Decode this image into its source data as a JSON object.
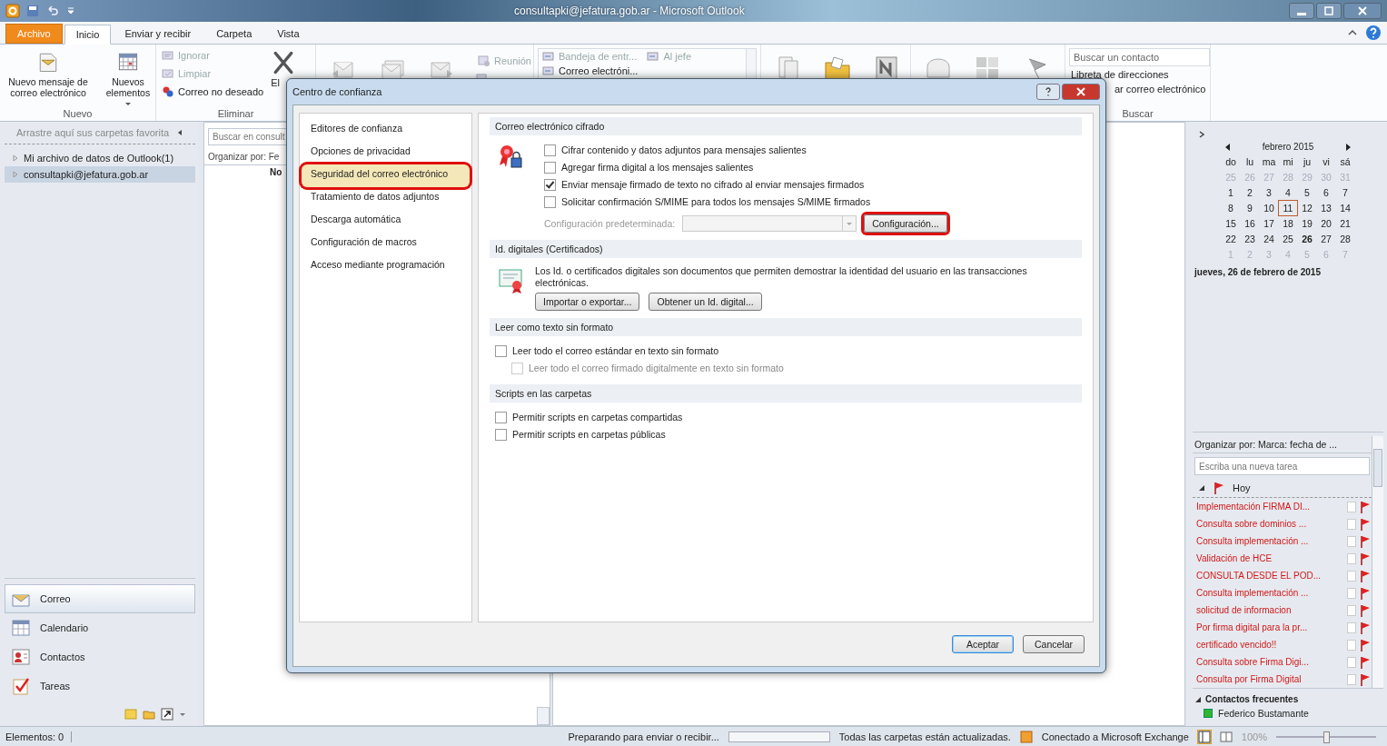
{
  "window": {
    "title": "consultapki@jefatura.gob.ar - Microsoft Outlook"
  },
  "tabs": [
    {
      "label": "Archivo",
      "kind": "file",
      "selected": false
    },
    {
      "label": "Inicio",
      "kind": "tab",
      "selected": true
    },
    {
      "label": "Enviar y recibir",
      "kind": "tab",
      "selected": false
    },
    {
      "label": "Carpeta",
      "kind": "tab",
      "selected": false
    },
    {
      "label": "Vista",
      "kind": "tab",
      "selected": false
    }
  ],
  "ribbon": {
    "new_mail": "Nuevo mensaje de correo electrónico",
    "new_items": "Nuevos elementos",
    "group_new": "Nuevo",
    "ignore": {
      "label": "Ignorar",
      "disabled": true
    },
    "clean": {
      "label": "Limpiar",
      "disabled": true
    },
    "junk": {
      "label": "Correo no deseado",
      "disabled": false
    },
    "delete_label": "El",
    "group_delete": "Eliminar",
    "meeting": {
      "label": "Reunión",
      "disabled": true
    },
    "quick_steps": [
      {
        "label": "Bandeja de entr...",
        "disabled": true
      },
      {
        "label": "Al jefe",
        "disabled": true
      },
      {
        "label": "Correo electróni...",
        "disabled": false
      }
    ],
    "contact_search": {
      "placeholder": "Buscar un contacto"
    },
    "address_book": "Libreta de direcciones",
    "filter_mail": "ar correo electrónico",
    "group_find": "Buscar"
  },
  "nav_pane": {
    "favorites_hint": "Arrastre aquí sus carpetas favorita",
    "folders": [
      {
        "label": "Mi archivo de datos de Outlook(1)",
        "expanded": false,
        "selected": false
      },
      {
        "label": "consultapki@jefatura.gob.ar",
        "expanded": false,
        "selected": true
      }
    ],
    "modules": [
      {
        "label": "Correo",
        "selected": true
      },
      {
        "label": "Calendario",
        "selected": false
      },
      {
        "label": "Contactos",
        "selected": false
      },
      {
        "label": "Tareas",
        "selected": false
      }
    ]
  },
  "mail_list": {
    "search_placeholder": "Buscar en consult",
    "arrange": "Organizar por: Fe",
    "column_text": "No"
  },
  "dialog": {
    "title": "Centro de confianza",
    "categories": [
      {
        "label": "Editores de confianza",
        "selected": false,
        "annotated": false
      },
      {
        "label": "Opciones de privacidad",
        "selected": false,
        "annotated": false
      },
      {
        "label": "Seguridad del correo electrónico",
        "selected": true,
        "annotated": true
      },
      {
        "label": "Tratamiento de datos adjuntos",
        "selected": false,
        "annotated": false
      },
      {
        "label": "Descarga automática",
        "selected": false,
        "annotated": false
      },
      {
        "label": "Configuración de macros",
        "selected": false,
        "annotated": false
      },
      {
        "label": "Acceso mediante programación",
        "selected": false,
        "annotated": false
      }
    ],
    "encryption": {
      "title": "Correo electrónico cifrado",
      "options": [
        {
          "label": "Cifrar contenido y datos adjuntos para mensajes salientes",
          "checked": false
        },
        {
          "label": "Agregar firma digital a los mensajes salientes",
          "checked": false
        },
        {
          "label": "Enviar mensaje firmado de texto no cifrado al enviar mensajes firmados",
          "checked": true
        },
        {
          "label": "Solicitar confirmación S/MIME para todos los mensajes S/MIME firmados",
          "checked": false
        }
      ],
      "default_setting_label": "Configuración predeterminada:",
      "settings_button": {
        "label": "Configuración...",
        "annotated": true
      }
    },
    "digital_ids": {
      "title": "Id. digitales (Certificados)",
      "description": "Los Id. o certificados digitales son documentos que permiten demostrar la identidad del usuario en las transacciones electrónicas.",
      "buttons": [
        "Importar o exportar...",
        "Obtener un Id. digital..."
      ]
    },
    "plain_text": {
      "title": "Leer como texto sin formato",
      "options": [
        {
          "label": "Leer todo el correo estándar en texto sin formato",
          "checked": false,
          "disabled": false,
          "children": [
            {
              "label": "Leer todo el correo firmado digitalmente en texto sin formato",
              "checked": false,
              "disabled": true
            }
          ]
        }
      ]
    },
    "scripts": {
      "title": "Scripts en las carpetas",
      "options": [
        {
          "label": "Permitir scripts en carpetas compartidas",
          "checked": false
        },
        {
          "label": "Permitir scripts en carpetas públicas",
          "checked": false
        }
      ]
    },
    "buttons": [
      {
        "label": "Aceptar",
        "default": true
      },
      {
        "label": "Cancelar",
        "default": false
      }
    ]
  },
  "todo_bar": {
    "calendar": {
      "month": "febrero 2015",
      "weekdays": [
        "do",
        "lu",
        "ma",
        "mi",
        "ju",
        "vi",
        "sá"
      ],
      "weeks": [
        [
          {
            "t": "25",
            "muted": true,
            "selected": false,
            "bold": false
          },
          {
            "t": "26",
            "muted": true,
            "selected": false,
            "bold": false
          },
          {
            "t": "27",
            "muted": true,
            "selected": false,
            "bold": false
          },
          {
            "t": "28",
            "muted": true,
            "selected": false,
            "bold": false
          },
          {
            "t": "29",
            "muted": true,
            "selected": false,
            "bold": false
          },
          {
            "t": "30",
            "muted": true,
            "selected": false,
            "bold": false
          },
          {
            "t": "31",
            "muted": true,
            "selected": false,
            "bold": false
          }
        ],
        [
          {
            "t": "1",
            "muted": false,
            "selected": false,
            "bold": false
          },
          {
            "t": "2",
            "muted": false,
            "selected": false,
            "bold": false
          },
          {
            "t": "3",
            "muted": false,
            "selected": false,
            "bold": false
          },
          {
            "t": "4",
            "muted": false,
            "selected": false,
            "bold": false
          },
          {
            "t": "5",
            "muted": false,
            "selected": false,
            "bold": false
          },
          {
            "t": "6",
            "muted": false,
            "selected": false,
            "bold": false
          },
          {
            "t": "7",
            "muted": false,
            "selected": false,
            "bold": false
          }
        ],
        [
          {
            "t": "8",
            "muted": false,
            "selected": false,
            "bold": false
          },
          {
            "t": "9",
            "muted": false,
            "selected": false,
            "bold": false
          },
          {
            "t": "10",
            "muted": false,
            "selected": false,
            "bold": false
          },
          {
            "t": "11",
            "muted": false,
            "selected": true,
            "bold": false
          },
          {
            "t": "12",
            "muted": false,
            "selected": false,
            "bold": false
          },
          {
            "t": "13",
            "muted": false,
            "selected": false,
            "bold": false
          },
          {
            "t": "14",
            "muted": false,
            "selected": false,
            "bold": false
          }
        ],
        [
          {
            "t": "15",
            "muted": false,
            "selected": false,
            "bold": false
          },
          {
            "t": "16",
            "muted": false,
            "selected": false,
            "bold": false
          },
          {
            "t": "17",
            "muted": false,
            "selected": false,
            "bold": false
          },
          {
            "t": "18",
            "muted": false,
            "selected": false,
            "bold": false
          },
          {
            "t": "19",
            "muted": false,
            "selected": false,
            "bold": false
          },
          {
            "t": "20",
            "muted": false,
            "selected": false,
            "bold": false
          },
          {
            "t": "21",
            "muted": false,
            "selected": false,
            "bold": false
          }
        ],
        [
          {
            "t": "22",
            "muted": false,
            "selected": false,
            "bold": false
          },
          {
            "t": "23",
            "muted": false,
            "selected": false,
            "bold": false
          },
          {
            "t": "24",
            "muted": false,
            "selected": false,
            "bold": false
          },
          {
            "t": "25",
            "muted": false,
            "selected": false,
            "bold": false
          },
          {
            "t": "26",
            "muted": false,
            "selected": false,
            "bold": true
          },
          {
            "t": "27",
            "muted": false,
            "selected": false,
            "bold": false
          },
          {
            "t": "28",
            "muted": false,
            "selected": false,
            "bold": false
          }
        ],
        [
          {
            "t": "1",
            "muted": true,
            "selected": false,
            "bold": false
          },
          {
            "t": "2",
            "muted": true,
            "selected": false,
            "bold": false
          },
          {
            "t": "3",
            "muted": true,
            "selected": false,
            "bold": false
          },
          {
            "t": "4",
            "muted": true,
            "selected": false,
            "bold": false
          },
          {
            "t": "5",
            "muted": true,
            "selected": false,
            "bold": false
          },
          {
            "t": "6",
            "muted": true,
            "selected": false,
            "bold": false
          },
          {
            "t": "7",
            "muted": true,
            "selected": false,
            "bold": false
          }
        ]
      ]
    },
    "date_text": "jueves, 26 de febrero de 2015",
    "tasks": {
      "arrange": "Organizar por: Marca: fecha de ...",
      "new_task_placeholder": "Escriba una nueva tarea",
      "group": "Hoy",
      "items": [
        {
          "label": "Implementación FIRMA DI...",
          "completed": false
        },
        {
          "label": "Consulta sobre dominios ...",
          "completed": false
        },
        {
          "label": "Consulta implementación ...",
          "completed": false
        },
        {
          "label": "Validación de HCE",
          "completed": false
        },
        {
          "label": "CONSULTA DESDE EL POD...",
          "completed": false
        },
        {
          "label": "Consulta implementación ...",
          "completed": false
        },
        {
          "label": "solicitud de informacion",
          "completed": false
        },
        {
          "label": "Por firma digital para la pr...",
          "completed": false
        },
        {
          "label": "certificado vencido!!",
          "completed": false
        },
        {
          "label": "Consulta sobre Firma Digi...",
          "completed": false
        },
        {
          "label": "Consulta por Firma Digital",
          "completed": false
        }
      ]
    },
    "frequent_contacts": {
      "title": "Contactos frecuentes",
      "contacts": [
        "Federico Bustamante"
      ]
    }
  },
  "status_bar": {
    "items_count": "Elementos: 0",
    "sync_status": "Preparando para enviar o recibir...",
    "folders_status": "Todas las carpetas están actualizadas.",
    "connection": "Conectado a Microsoft Exchange",
    "zoom": "100%",
    "zoom_slider": {
      "level": 0.5
    }
  }
}
